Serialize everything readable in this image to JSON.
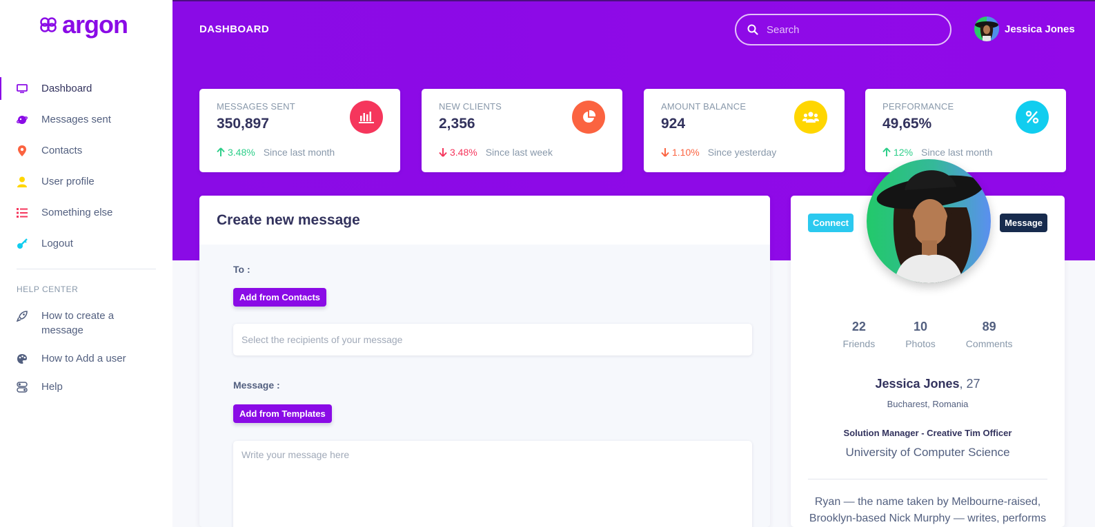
{
  "app": {
    "logo_text": "argon",
    "page_title": "DASHBOARD"
  },
  "colors": {
    "brand": "#8a0be6",
    "up": "#2dce89",
    "down": "#f5365c",
    "down_alt": "#fb6340"
  },
  "search": {
    "placeholder": "Search"
  },
  "user": {
    "name": "Jessica Jones"
  },
  "sidebar": {
    "items": [
      {
        "label": "Dashboard",
        "icon": "tv-icon"
      },
      {
        "label": "Messages sent",
        "icon": "planet-icon"
      },
      {
        "label": "Contacts",
        "icon": "pin-icon"
      },
      {
        "label": "User profile",
        "icon": "user-icon"
      },
      {
        "label": "Something else",
        "icon": "bullet-list-icon"
      },
      {
        "label": "Logout",
        "icon": "key-icon"
      }
    ],
    "help_heading": "HELP CENTER",
    "help_items": [
      {
        "label": "How to create a message",
        "icon": "spaceship-icon"
      },
      {
        "label": "How to Add a user",
        "icon": "palette-icon"
      },
      {
        "label": "Help",
        "icon": "ui-04-icon"
      }
    ]
  },
  "stats": [
    {
      "title": "MESSAGES SENT",
      "value": "350,897",
      "pct": "3.48%",
      "since": "Since last month",
      "trend": "up",
      "icon": "chart-bar-icon",
      "icon_bg": "#f5365c"
    },
    {
      "title": "NEW CLIENTS",
      "value": "2,356",
      "pct": "3.48%",
      "since": "Since last week",
      "trend": "down",
      "icon": "chart-pie-icon",
      "icon_bg": "#fb6340"
    },
    {
      "title": "AMOUNT BALANCE",
      "value": "924",
      "pct": "1.10%",
      "since": "Since yesterday",
      "trend": "down",
      "icon": "users-icon",
      "icon_bg": "#ffd600"
    },
    {
      "title": "PERFORMANCE",
      "value": "49,65%",
      "pct": "12%",
      "since": "Since last month",
      "trend": "up",
      "icon": "percent-icon",
      "icon_bg": "#11cdef"
    }
  ],
  "message_form": {
    "title": "Create new message",
    "to_label": "To :",
    "add_contacts": "Add from Contacts",
    "recipients_placeholder": "Select the recipients of your message",
    "message_label": "Message :",
    "add_templates": "Add from Templates",
    "message_placeholder": "Write your message here"
  },
  "profile": {
    "connect": "Connect",
    "message": "Message",
    "friends": "22",
    "friends_label": "Friends",
    "photos": "10",
    "photos_label": "Photos",
    "comments": "89",
    "comments_label": "Comments",
    "name": "Jessica Jones",
    "age": ", 27",
    "location": "Bucharest, Romania",
    "job": "Solution Manager - Creative Tim Officer",
    "university": "University of Computer Science",
    "bio": "Ryan — the name taken by Melbourne-raised, Brooklyn-based Nick Murphy — writes, performs"
  }
}
